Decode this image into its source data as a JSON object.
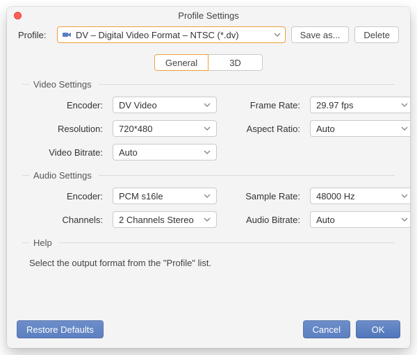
{
  "window": {
    "title": "Profile Settings"
  },
  "profile": {
    "label": "Profile:",
    "value": "DV – Digital Video Format – NTSC (*.dv)",
    "save_as": "Save as...",
    "delete": "Delete"
  },
  "tabs": {
    "general": "General",
    "three_d": "3D",
    "active": "general"
  },
  "video": {
    "title": "Video Settings",
    "encoder_label": "Encoder:",
    "encoder": "DV Video",
    "resolution_label": "Resolution:",
    "resolution": "720*480",
    "video_bitrate_label": "Video Bitrate:",
    "video_bitrate": "Auto",
    "frame_rate_label": "Frame Rate:",
    "frame_rate": "29.97 fps",
    "aspect_ratio_label": "Aspect Ratio:",
    "aspect_ratio": "Auto"
  },
  "audio": {
    "title": "Audio Settings",
    "encoder_label": "Encoder:",
    "encoder": "PCM s16le",
    "channels_label": "Channels:",
    "channels": "2 Channels Stereo",
    "sample_rate_label": "Sample Rate:",
    "sample_rate": "48000 Hz",
    "audio_bitrate_label": "Audio Bitrate:",
    "audio_bitrate": "Auto"
  },
  "help": {
    "title": "Help",
    "text": "Select the output format from the \"Profile\" list."
  },
  "footer": {
    "restore": "Restore Defaults",
    "cancel": "Cancel",
    "ok": "OK"
  }
}
